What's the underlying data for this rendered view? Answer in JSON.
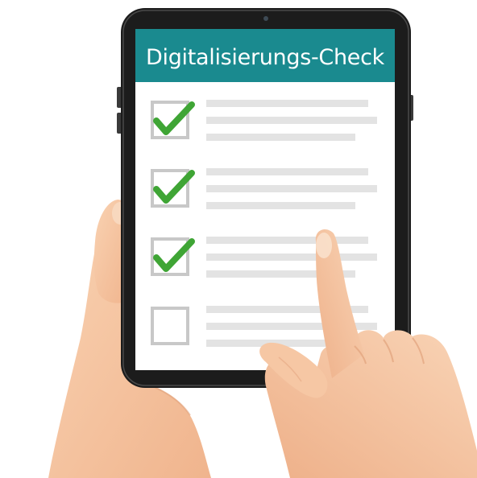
{
  "screen": {
    "title": "Digitalisierungs-Check"
  },
  "checklist": {
    "items": [
      {
        "checked": true
      },
      {
        "checked": true
      },
      {
        "checked": true
      },
      {
        "checked": false
      }
    ]
  },
  "colors": {
    "header": "#1a8a8f",
    "check": "#3fa535",
    "checkbox_border": "#c8c8c8",
    "placeholder_line": "#e3e3e3",
    "tablet_frame": "#1c1c1c",
    "skin": "#f6c7a4",
    "skin_shadow": "#e8a982"
  },
  "icons": {
    "checkmark": "check-icon",
    "camera": "camera-icon"
  }
}
